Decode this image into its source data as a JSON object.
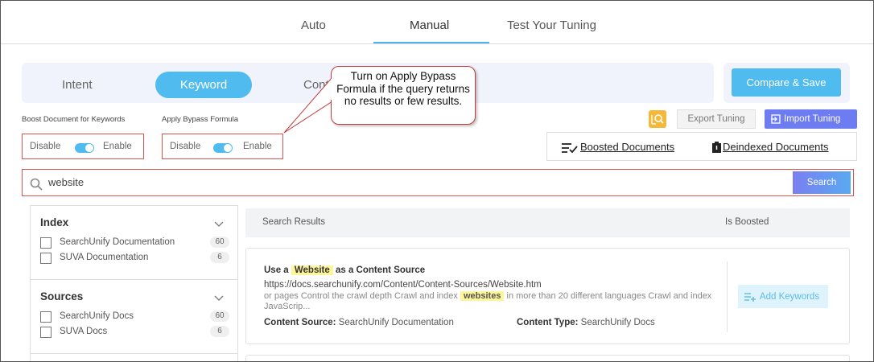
{
  "top_tabs": [
    "Auto",
    "Manual",
    "Test Your Tuning"
  ],
  "sub_tabs": [
    "Intent",
    "Keyword",
    "Cont"
  ],
  "compare_button": "Compare & Save",
  "callout_text": "Turn on Apply Bypass Formula if the query returns no results or few results.",
  "boost": {
    "label": "Boost Document for Keywords",
    "disable": "Disable",
    "enable": "Enable",
    "state": "enabled"
  },
  "bypass": {
    "label": "Apply Bypass Formula",
    "disable": "Disable",
    "enable": "Enable",
    "state": "enabled"
  },
  "export_button": "Export Tuning",
  "import_button": "Import Tuning",
  "boosted_docs": "Boosted Documents",
  "deindexed_docs": "Deindexed Documents",
  "search": {
    "value": "website",
    "button": "Search"
  },
  "filters": {
    "index": {
      "title": "Index",
      "items": [
        {
          "label": "SearchUnify Documentation",
          "count": "60"
        },
        {
          "label": "SUVA Documentation",
          "count": "6"
        }
      ]
    },
    "sources": {
      "title": "Sources",
      "items": [
        {
          "label": "SearchUnify Docs",
          "count": "60"
        },
        {
          "label": "SUVA Docs",
          "count": "6"
        }
      ]
    }
  },
  "results_header": {
    "left": "Search Results",
    "right": "Is Boosted"
  },
  "result": {
    "title_pre": "Use a",
    "title_hl": "Website",
    "title_post": "as a Content Source",
    "url": "https://docs.searchunify.com/Content/Content-Sources/Website.htm",
    "snippet_pre": "or pages Control the crawl depth Crawl and index",
    "snippet_hl": "websites",
    "snippet_post": "in more than 20 different languages Crawl and index JavaScrip...",
    "source_label": "Content Source:",
    "source_value": "SearchUnify Documentation",
    "type_label": "Content Type:",
    "type_value": "SearchUnify Docs",
    "add_keywords": "Add Keywords"
  },
  "colors": {
    "accent": "#4fbbee",
    "import": "#6e7cf2",
    "highlight_border": "#d9534f",
    "hit_highlight": "#fdf59a"
  }
}
